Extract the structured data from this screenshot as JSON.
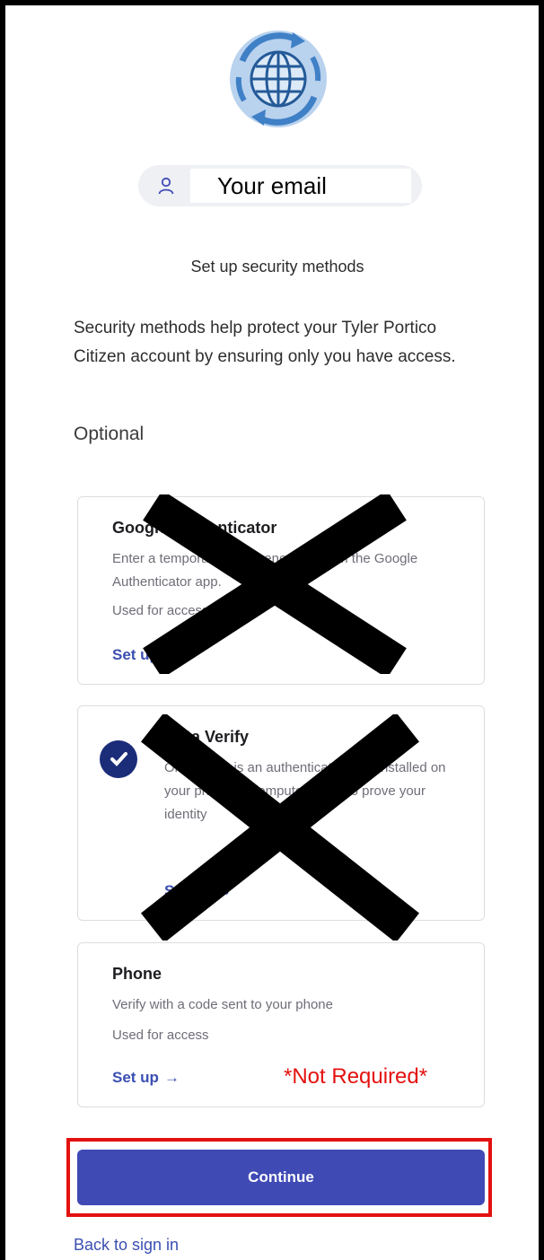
{
  "email": {
    "placeholder": "Your email",
    "icon": "user-icon"
  },
  "heading": "Set up security methods",
  "description": "Security methods help protect your Tyler Portico Citizen account by ensuring only you have access.",
  "optional_label": "Optional",
  "methods": [
    {
      "title": "Google Authenticator",
      "description": "Enter a temporary code generated from the Google Authenticator app.",
      "usage": "Used for access",
      "setup_label": "Set up",
      "crossed_out": true
    },
    {
      "title": "Okta Verify",
      "description": "Okta Verify is an authenticator app, installed on your phone or computer, used to prove your identity",
      "usage": "Used for access",
      "setup_label": "Set up",
      "crossed_out": true,
      "icon": "check-circle-icon"
    },
    {
      "title": "Phone",
      "description": "Verify with a code sent to your phone",
      "usage": "Used for access",
      "setup_label": "Set up",
      "crossed_out": false
    }
  ],
  "annotation_not_required": "*Not Required*",
  "continue_label": "Continue",
  "back_label": "Back to sign in",
  "colors": {
    "primary": "#3f4ab5",
    "link": "#3b4fb2",
    "annotation_red": "#e3110f",
    "check_badge": "#1b2d79"
  }
}
